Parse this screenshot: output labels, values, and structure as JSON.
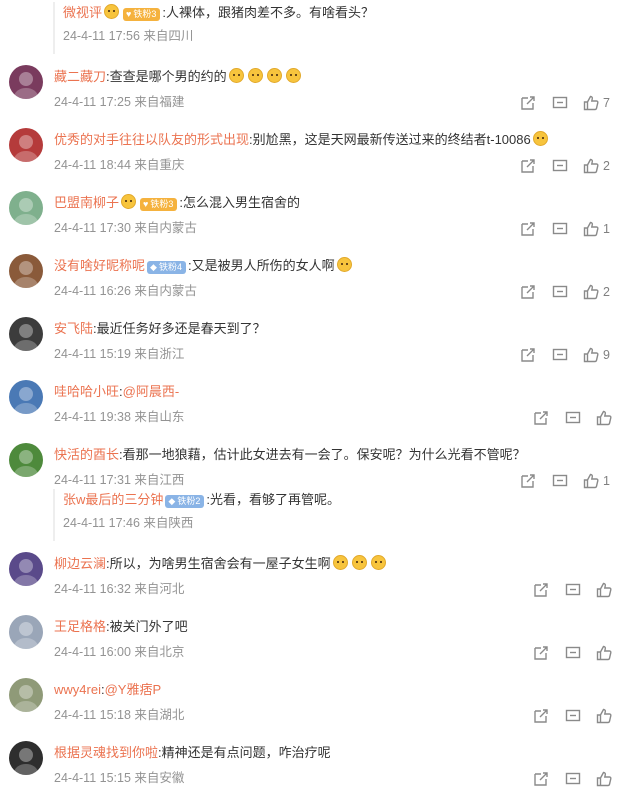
{
  "colors": {
    "username": "#eb7350",
    "meta": "#939393",
    "icon": "#8a8a8a",
    "reply_border": "#eeeeee"
  },
  "comments": [
    {
      "user": "",
      "text": "",
      "meta": ""
    },
    {
      "user": "藏二藏刀",
      "text": "查查是哪个男的约的",
      "meta": "24-4-11 17:25 来自福建",
      "likes": "7",
      "emoji": "quiet-face-emoji"
    },
    {
      "user": "优秀的对手往往以队友的形式出现",
      "text": "别尬黑，这是天网最新传送过来的终结者t-10086",
      "meta": "24-4-11 18:44 来自重庆",
      "likes": "2",
      "emoji": "robot-face-emoji"
    },
    {
      "user": "巴盟南柳子",
      "badge": "铁粉3",
      "text": "怎么混入男生宿舍的",
      "meta": "24-4-11 17:30 来自内蒙古",
      "likes": "1"
    },
    {
      "user": "没有啥好昵称呢",
      "badge": "铁粉4",
      "text": "又是被男人所伤的女人啊",
      "meta": "24-4-11 16:26 来自内蒙古",
      "likes": "2",
      "emoji": "sweat-face-emoji"
    },
    {
      "user": "安飞陆",
      "text": "最近任务好多还是春天到了？",
      "meta": "24-4-11 15:19 来自浙江",
      "likes": "9"
    },
    {
      "user": "哇哈哈小旺",
      "text": "",
      "mention": "@阿晨西-",
      "meta": "24-4-11 19:38 来自山东",
      "likes": ""
    },
    {
      "user": "快活的酉长",
      "text": "看那一地狼藉，估计此女进去有一会了。保安呢？为什么光看不管呢？",
      "meta": "24-4-11 17:31 来自江西",
      "likes": "1"
    },
    {
      "user": "柳边云澜",
      "text": "所以，为啥男生宿舍会有一屋子女生啊",
      "meta": "24-4-11 16:32 来自河北",
      "likes": "",
      "emoji": "thinking-face-emoji"
    },
    {
      "user": "王足格格",
      "text": "被关门外了吧",
      "meta": "24-4-11 16:00 来自北京",
      "likes": ""
    },
    {
      "user": "wwy4rei",
      "text": "",
      "mention": "@Y雅痞P",
      "meta": "24-4-11 15:18 来自湖北",
      "likes": ""
    },
    {
      "user": "根据灵魂找到你啦",
      "text": "精神还是有点问题，咋治疗呢",
      "meta": "24-4-11 15:15 来自安徽",
      "likes": ""
    }
  ],
  "replies": [
    {
      "user": "微视评",
      "badge": "铁粉3",
      "text": "人裸体，跟猪肉差不多。有啥看头？",
      "meta": "24-4-11 17:56 来自四川"
    },
    {
      "user": "张w最后的三分钟",
      "badge": "铁粉2",
      "text": "光看，看够了再管呢。",
      "meta": "24-4-11 17:46 来自陕西"
    }
  ]
}
